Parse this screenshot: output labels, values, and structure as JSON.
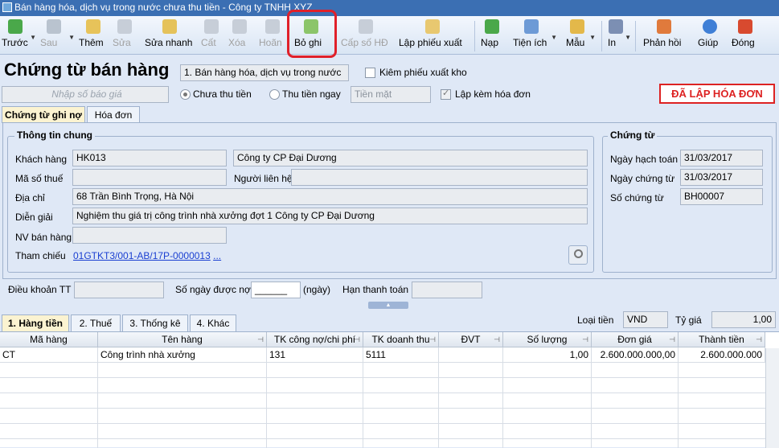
{
  "window": {
    "title": "Bán hàng hóa, dịch vụ trong nước chưa thu tiền - Công ty TNHH XYZ"
  },
  "toolbar": {
    "prev": "Trước",
    "next": "Sau",
    "add": "Thêm",
    "edit": "Sửa",
    "quick_edit": "Sửa nhanh",
    "save": "Cất",
    "delete": "Xóa",
    "undo": "Hoãn",
    "unpost": "Bỏ ghi",
    "issue_no": "Cấp số HĐ",
    "create_slip": "Lập phiếu xuất",
    "load": "Nạp",
    "utilities": "Tiện ích",
    "template": "Mẫu",
    "print": "In",
    "feedback": "Phản hồi",
    "help": "Giúp",
    "close": "Đóng"
  },
  "header": {
    "title": "Chứng từ bán hàng",
    "type_select": "1. Bán hàng hóa, dịch vụ trong nước",
    "check_export_slip": "Kiêm phiếu xuất kho",
    "quote_placeholder": "Nhập số báo giá",
    "radio_unpaid": "Chưa thu tiền",
    "radio_paid": "Thu tiền ngay",
    "payment_method": "Tiền mặt",
    "check_invoice": "Lập kèm hóa đơn",
    "invoice_status": "ĐÃ LẬP HÓA ĐƠN"
  },
  "tabs": {
    "debit": "Chứng từ ghi nợ",
    "invoice": "Hóa đơn"
  },
  "general": {
    "title": "Thông tin chung",
    "customer_label": "Khách hàng",
    "customer_code": "HK013",
    "customer_name": "Công ty CP Đại Dương",
    "tax_label": "Mã số thuế",
    "tax_value": "",
    "contact_label": "Người liên hệ",
    "contact_value": "",
    "address_label": "Địa chỉ",
    "address_value": "68 Trần Bình Trọng, Hà Nội",
    "desc_label": "Diễn giải",
    "desc_value": "Nghiệm thu giá trị công trình nhà xưởng đợt 1 Công ty CP Đại Dương",
    "staff_label": "NV bán hàng",
    "staff_value": "",
    "ref_label": "Tham chiếu",
    "ref_value": "01GTKT3/001-AB/17P-0000013",
    "ref_more": "..."
  },
  "voucher": {
    "title": "Chứng từ",
    "post_date_label": "Ngày hạch toán",
    "post_date": "31/03/2017",
    "doc_date_label": "Ngày chứng từ",
    "doc_date": "31/03/2017",
    "doc_no_label": "Số chứng từ",
    "doc_no": "BH00007"
  },
  "terms": {
    "terms_label": "Điều khoản TT",
    "days_label": "Số ngày được nợ",
    "days_value": "______",
    "days_unit": "(ngày)",
    "due_label": "Hạn thanh toán"
  },
  "bottom_tabs": {
    "goods": "1. Hàng tiền",
    "tax": "2. Thuế",
    "stats": "3. Thống kê",
    "other": "4. Khác"
  },
  "currency": {
    "label": "Loại tiền",
    "value": "VND",
    "rate_label": "Tỷ giá",
    "rate_value": "1,00"
  },
  "grid": {
    "columns": [
      "Mã hàng",
      "Tên hàng",
      "TK công nợ/chi phí",
      "TK doanh thu",
      "ĐVT",
      "Số lượng",
      "Đơn giá",
      "Thành tiền"
    ],
    "rows": [
      [
        "CT",
        "Công trình nhà xưởng",
        "131",
        "5111",
        "",
        "1,00",
        "2.600.000.000,00",
        "2.600.000.000"
      ]
    ]
  }
}
